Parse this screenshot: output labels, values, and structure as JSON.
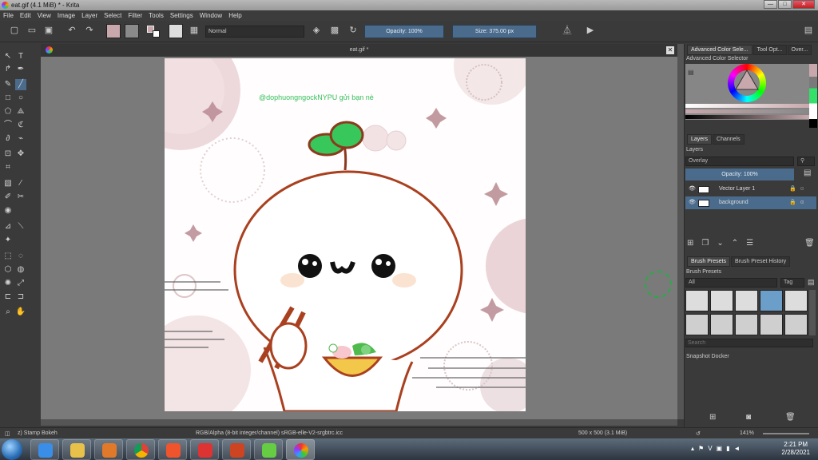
{
  "window": {
    "title": "eat.gif (4.1 MiB)  * - Krita",
    "minimize": "—",
    "maximize": "□",
    "close": "✕"
  },
  "menu": [
    "File",
    "Edit",
    "View",
    "Image",
    "Layer",
    "Select",
    "Filter",
    "Tools",
    "Settings",
    "Window",
    "Help"
  ],
  "toolbar": {
    "blend_mode": "Normal",
    "opacity": "Opacity: 100%",
    "size": "Size: 375.00 px",
    "fg_color": "#c8a8ac",
    "bg_color": "#8a8a8a"
  },
  "document": {
    "tab_title": "eat.gif *",
    "watermark": "@dophuongngockNYPU gửi bạn nè"
  },
  "docker": {
    "color_tabs": [
      "Advanced Color Sele...",
      "Tool Opt...",
      "Over..."
    ],
    "color_title": "Advanced Color Selector",
    "layer_tabs": [
      "Layers",
      "Channels"
    ],
    "layers_title": "Layers",
    "layer_blend": "Overlay",
    "layer_opacity": "Opacity:  100%",
    "layers": [
      {
        "name": "Vector Layer 1",
        "selected": false
      },
      {
        "name": "background",
        "selected": true
      }
    ],
    "brush_tabs": [
      "Brush Presets",
      "Brush Preset History"
    ],
    "brush_title": "Brush Presets",
    "brush_filter": "All",
    "brush_tag": "Tag",
    "search_placeholder": "Search",
    "snapshot": "Snapshot Docker"
  },
  "status": {
    "tool": "z) Stamp Bokeh",
    "colorspace": "RGB/Alpha (8-bit integer/channel)  sRGB-elle-V2-srgbtrc.icc",
    "dimensions": "500 x 500 (3.1 MiB)",
    "zoom": "141%"
  },
  "taskbar": {
    "time": "2:21 PM",
    "date": "2/28/2021"
  }
}
